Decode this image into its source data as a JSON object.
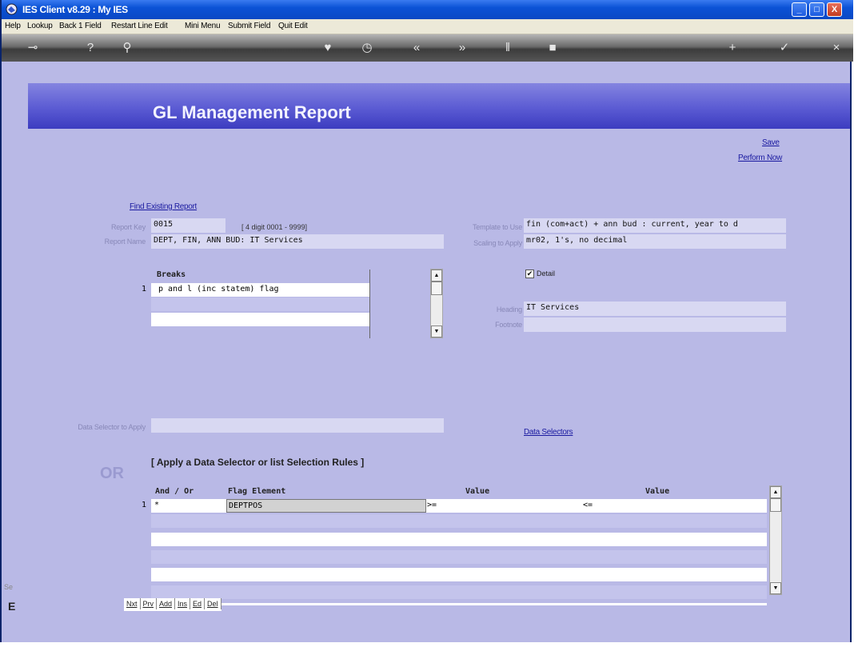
{
  "window": {
    "title": "IES Client v8.29 : My IES",
    "controls": [
      "_",
      "□",
      "X"
    ]
  },
  "menubar": [
    "Help",
    "Lookup",
    "Back 1 Field",
    "Restart Line Edit",
    "Mini Menu",
    "Submit Field",
    "Quit Edit"
  ],
  "toolbar": {
    "icons": [
      "key-icon",
      "help-icon",
      "search-icon",
      "heart-icon",
      "clock-icon",
      "rewind-icon",
      "forward-icon",
      "pause-icon",
      "stop-icon",
      "add-icon",
      "check-icon",
      "close-icon"
    ]
  },
  "page": {
    "title": "GL Management Report",
    "links": {
      "save": "Save",
      "perform_now": "Perform Now",
      "find_existing": "Find Existing Report",
      "data_selectors": "Data Selectors"
    },
    "report_key": {
      "label": "Report Key",
      "value": "0015",
      "hint": "[ 4 digit 0001 - 9999]"
    },
    "report_name": {
      "label": "Report Name",
      "value": "DEPT, FIN, ANN BUD: IT Services"
    },
    "template": {
      "label": "Template to Use",
      "value": "fin (com+act) + ann bud : current, year to d"
    },
    "scaling": {
      "label": "Scaling to Apply",
      "value": "mr02, 1's, no decimal"
    },
    "detail": {
      "label": "Detail",
      "checked": true
    },
    "heading": {
      "label": "Heading",
      "value": "IT Services"
    },
    "footnote": {
      "label": "Footnote",
      "value": ""
    },
    "breaks": {
      "header": "Breaks",
      "rows": [
        {
          "num": "1",
          "value": "p and l (inc statem) flag"
        },
        {
          "num": "",
          "value": ""
        },
        {
          "num": "",
          "value": ""
        }
      ]
    },
    "data_selector": {
      "label": "Data Selector to Apply",
      "value": ""
    },
    "or_label": "OR",
    "apply_label": "[ Apply a Data Selector or list Selection Rules ]",
    "rules": {
      "headers": {
        "and_or": "And / Or",
        "flag_element": "Flag Element",
        "value1": "Value",
        "value2": "Value"
      },
      "rows": [
        {
          "num": "1",
          "and_or": "*",
          "flag": "DEPTPOS",
          "op1": ">=",
          "op2": "<="
        },
        {
          "num": "",
          "and_or": "",
          "flag": "",
          "op1": "",
          "op2": ""
        },
        {
          "num": "",
          "and_or": "",
          "flag": "",
          "op1": "",
          "op2": ""
        },
        {
          "num": "",
          "and_or": "",
          "flag": "",
          "op1": "",
          "op2": ""
        },
        {
          "num": "",
          "and_or": "",
          "flag": "",
          "op1": "",
          "op2": ""
        }
      ]
    },
    "footer_buttons": [
      "Nxt",
      "Prv",
      "Add",
      "Ins",
      "Ed",
      "Del"
    ],
    "left_fragments": {
      "top": "Se",
      "bottom": "E"
    }
  }
}
